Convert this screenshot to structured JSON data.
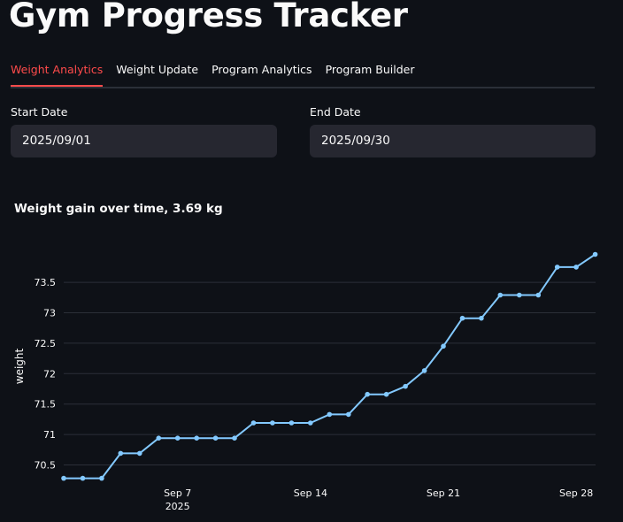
{
  "app": {
    "title": "Gym Progress Tracker"
  },
  "tabs": [
    {
      "label": "Weight Analytics",
      "active": true
    },
    {
      "label": "Weight Update",
      "active": false
    },
    {
      "label": "Program Analytics",
      "active": false
    },
    {
      "label": "Program Builder",
      "active": false
    }
  ],
  "filters": {
    "start": {
      "label": "Start Date",
      "value": "2025/09/01"
    },
    "end": {
      "label": "End Date",
      "value": "2025/09/30"
    }
  },
  "chart_heading": "Weight gain over time,  3.69 kg",
  "colors": {
    "accent": "#ff4b4b",
    "line": "#83c9ff",
    "background": "#0e1117",
    "input": "#262730",
    "grid": "#2b2f38"
  },
  "chart_data": {
    "type": "line",
    "title": "Weight gain over time,  3.69 kg",
    "ylabel": "weight",
    "xlabel": "",
    "x_ticks": [
      {
        "date": "2025-09-07",
        "label": "Sep 7",
        "sublabel": "2025"
      },
      {
        "date": "2025-09-14",
        "label": "Sep 14",
        "sublabel": ""
      },
      {
        "date": "2025-09-21",
        "label": "Sep 21",
        "sublabel": ""
      },
      {
        "date": "2025-09-28",
        "label": "Sep 28",
        "sublabel": ""
      }
    ],
    "y_ticks": [
      70.5,
      71,
      71.5,
      72,
      72.5,
      73,
      73.5
    ],
    "grid": true,
    "series": [
      {
        "x": [
          "2025-09-01",
          "2025-09-02",
          "2025-09-03",
          "2025-09-04",
          "2025-09-05",
          "2025-09-06",
          "2025-09-07",
          "2025-09-08",
          "2025-09-09",
          "2025-09-10",
          "2025-09-11",
          "2025-09-12",
          "2025-09-13",
          "2025-09-14",
          "2025-09-15",
          "2025-09-16",
          "2025-09-17",
          "2025-09-18",
          "2025-09-19",
          "2025-09-20",
          "2025-09-21",
          "2025-09-22",
          "2025-09-23",
          "2025-09-24",
          "2025-09-25",
          "2025-09-26",
          "2025-09-27",
          "2025-09-28",
          "2025-09-29"
        ],
        "y": [
          70.28,
          70.28,
          70.28,
          70.69,
          70.69,
          70.94,
          70.94,
          70.94,
          70.94,
          70.94,
          71.19,
          71.19,
          71.19,
          71.19,
          71.33,
          71.33,
          71.66,
          71.66,
          71.79,
          72.05,
          72.45,
          72.91,
          72.91,
          73.29,
          73.29,
          73.29,
          73.75,
          73.75,
          73.96
        ]
      }
    ]
  }
}
